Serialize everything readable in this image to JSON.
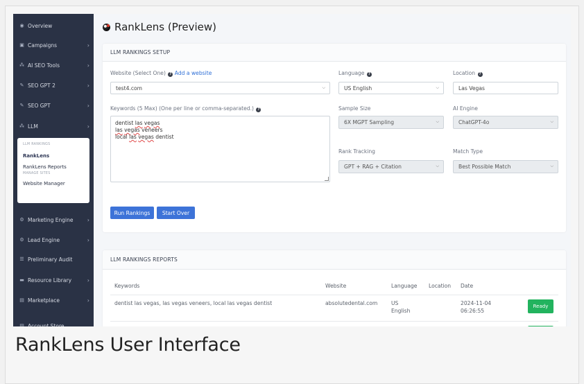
{
  "sidebar": {
    "items": [
      {
        "label": "Overview",
        "icon": "eye-icon",
        "glyph": "◉",
        "chevron": false
      },
      {
        "label": "Campaigns",
        "icon": "briefcase-icon",
        "glyph": "▣",
        "chevron": true
      },
      {
        "label": "AI SEO Tools",
        "icon": "sitemap-icon",
        "glyph": "⁂",
        "chevron": true
      },
      {
        "label": "SEO GPT 2",
        "icon": "edit-icon",
        "glyph": "✎",
        "chevron": true
      },
      {
        "label": "SEO GPT",
        "icon": "edit-icon",
        "glyph": "✎",
        "chevron": true
      },
      {
        "label": "LLM",
        "icon": "sitemap-icon",
        "glyph": "⁂",
        "chevron": true
      },
      {
        "label": "Marketing Engine",
        "icon": "cogs-icon",
        "glyph": "⚙",
        "chevron": true
      },
      {
        "label": "Lead Engine",
        "icon": "gear-icon",
        "glyph": "⚙",
        "chevron": true
      },
      {
        "label": "Preliminary Audit",
        "icon": "list-icon",
        "glyph": "☰",
        "chevron": false
      },
      {
        "label": "Resource Library",
        "icon": "folder-icon",
        "glyph": "▬",
        "chevron": true
      },
      {
        "label": "Marketplace",
        "icon": "store-icon",
        "glyph": "▤",
        "chevron": true
      },
      {
        "label": "Account Store",
        "icon": "store-icon",
        "glyph": "▤",
        "chevron": false
      }
    ],
    "submenu": {
      "heading1": "LLM RANKINGS",
      "item1": "RankLens",
      "item2": "RankLens Reports",
      "heading2": "MANAGE SITES",
      "item3": "Website Manager"
    }
  },
  "page": {
    "title": "RankLens (Preview)"
  },
  "setup": {
    "heading": "LLM RANKINGS SETUP",
    "website_label": "Website (Select One)",
    "add_website_link": "Add a website",
    "website_value": "test4.com",
    "language_label": "Language",
    "language_value": "US English",
    "location_label": "Location",
    "location_value": "Las Vegas",
    "keywords_label": "Keywords (5 Max) (One per line or comma-separated.)",
    "keywords": [
      "dentist las vegas",
      "las vegas veneers",
      "local las vegas dentist"
    ],
    "sample_size_label": "Sample Size",
    "sample_size_value": "6X MGPT Sampling",
    "ai_engine_label": "AI Engine",
    "ai_engine_value": "ChatGPT-4o",
    "rank_tracking_label": "Rank Tracking",
    "rank_tracking_value": "GPT + RAG + Citation",
    "match_type_label": "Match Type",
    "match_type_value": "Best Possible Match",
    "run_button": "Run Rankings",
    "start_over_button": "Start Over"
  },
  "reports": {
    "heading": "LLM RANKINGS REPORTS",
    "columns": [
      "Keywords",
      "Website",
      "Language",
      "Location",
      "Date"
    ],
    "rows": [
      {
        "keywords": "dentist las vegas, las vegas veneers, local las vegas dentist",
        "website": "absolutedental.com",
        "language_line1": "US",
        "language_line2": "English",
        "location": "",
        "date_line1": "2024-11-04",
        "date_line2": "06:26:55",
        "status": "Ready"
      }
    ]
  },
  "caption": "RankLens User Interface",
  "colors": {
    "sidebar_bg": "#2a3245",
    "primary_button": "#3d73d8",
    "status_ready": "#22b35e",
    "link": "#2f6fd6"
  }
}
